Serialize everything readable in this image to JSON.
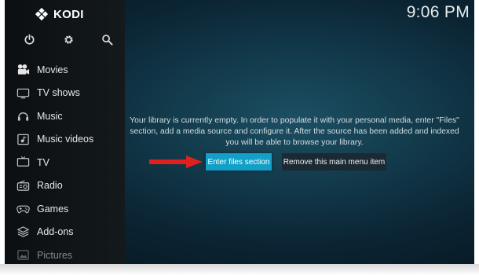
{
  "app": {
    "name": "KODI"
  },
  "clock": "9:06 PM",
  "top_icons": [
    "power-icon",
    "settings-icon",
    "search-icon"
  ],
  "menu": [
    {
      "label": "Movies",
      "icon": "movies-icon"
    },
    {
      "label": "TV shows",
      "icon": "tv-shows-icon"
    },
    {
      "label": "Music",
      "icon": "music-icon"
    },
    {
      "label": "Music videos",
      "icon": "music-videos-icon"
    },
    {
      "label": "TV",
      "icon": "tv-icon"
    },
    {
      "label": "Radio",
      "icon": "radio-icon"
    },
    {
      "label": "Games",
      "icon": "games-icon"
    },
    {
      "label": "Add-ons",
      "icon": "addons-icon"
    },
    {
      "label": "Pictures",
      "icon": "pictures-icon"
    }
  ],
  "main": {
    "message": "Your library is currently empty. In order to populate it with your personal media, enter \"Files\" section, add a media source and configure it. After the source has been added and indexed you will be able to browse your library.",
    "primary_button": "Enter files section",
    "secondary_button": "Remove this main menu item"
  },
  "colors": {
    "accent": "#12a0c9",
    "annotation_arrow": "#e0201c",
    "sidebar": "#111619",
    "background": "#123a4b"
  }
}
